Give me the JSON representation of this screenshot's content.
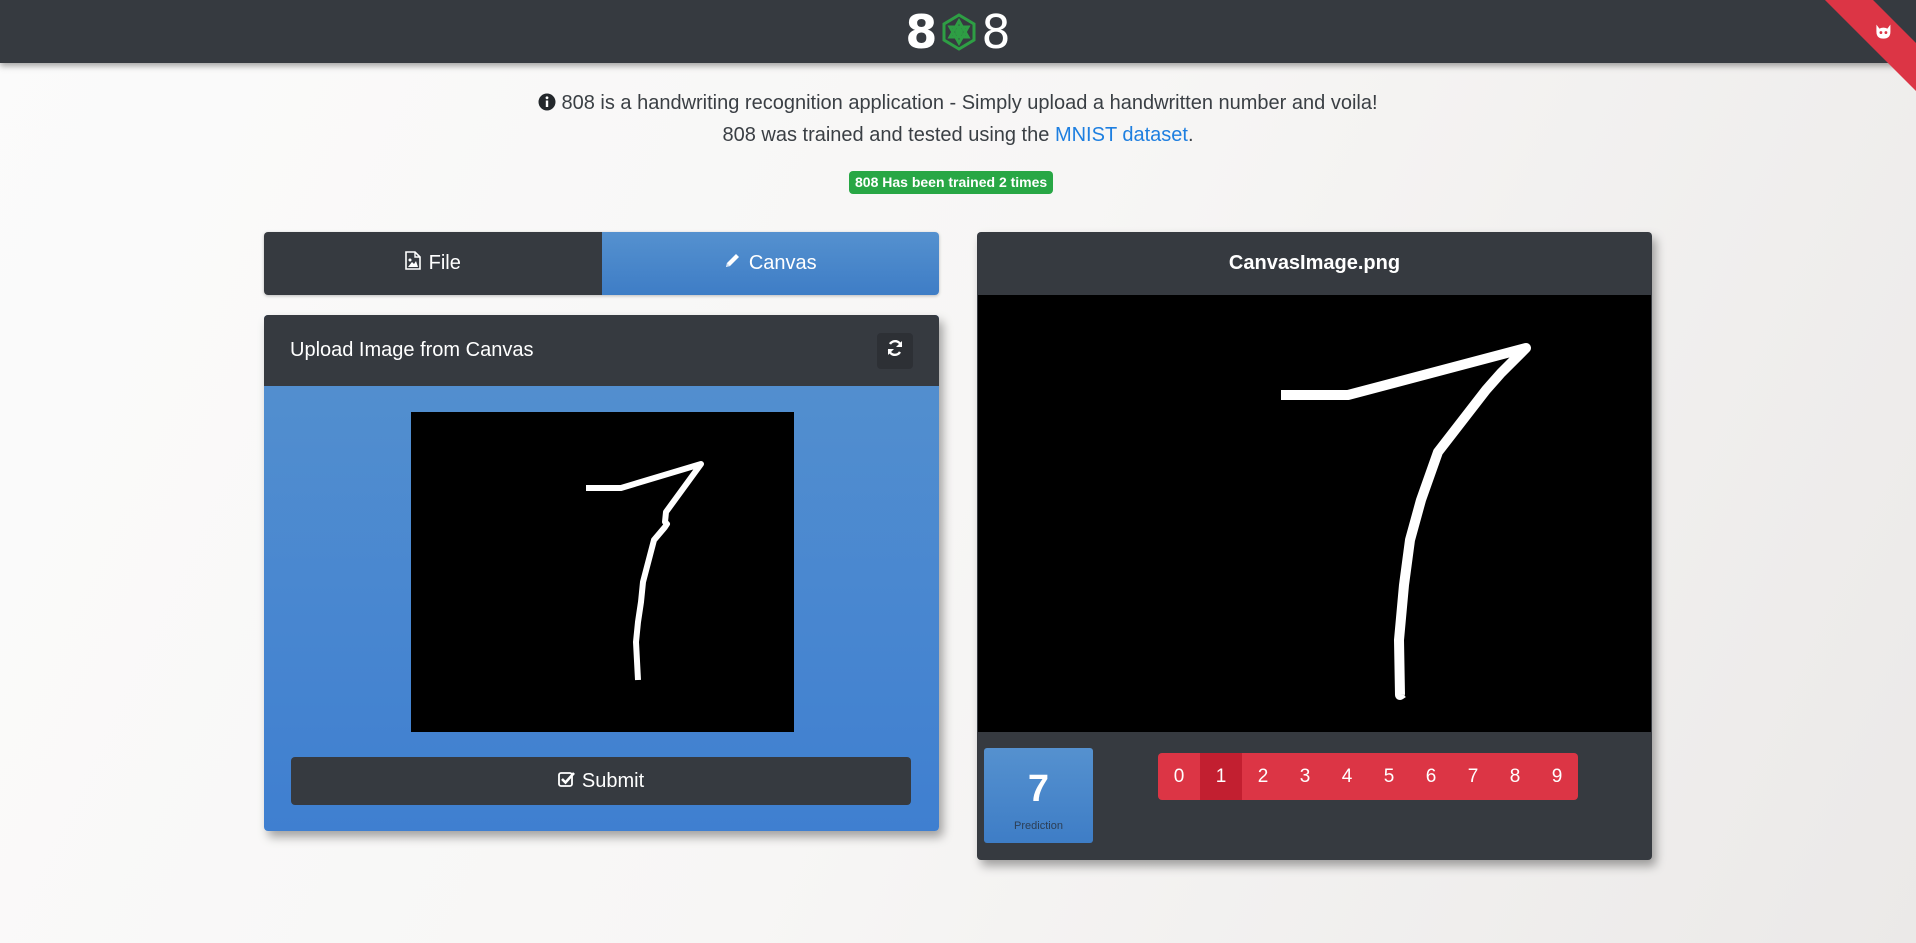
{
  "navbar": {
    "brand_left": "8",
    "brand_right": "8",
    "icons": {
      "brand_middle": "atom-logo-icon",
      "ribbon": "github-cat-icon"
    },
    "colors": {
      "background": "#363a40",
      "logo_green": "#2e9e44",
      "ribbon": "#dc3545"
    }
  },
  "intro": {
    "line1": "808 is a handwriting recognition application - Simply upload a handwritten number and voila!",
    "line2_prefix": "808 was trained and tested using the",
    "link_text": "MNIST dataset",
    "line2_suffix": ".",
    "icon": "info-circle-icon"
  },
  "badge": {
    "text": "808 Has been trained 2 times",
    "color": "#28a745"
  },
  "tabs": [
    {
      "label": "File",
      "icon": "file-image-icon",
      "active": false
    },
    {
      "label": "Canvas",
      "icon": "pencil-icon",
      "active": true
    }
  ],
  "upload_panel": {
    "title": "Upload Image from Canvas",
    "refresh_icon": "refresh-icon",
    "submit_label": "Submit",
    "submit_icon": "check-square-icon"
  },
  "result_panel": {
    "filename": "CanvasImage.png",
    "prediction_value": "7",
    "prediction_label": "Prediction",
    "digits": [
      "0",
      "1",
      "2",
      "3",
      "4",
      "5",
      "6",
      "7",
      "8",
      "9"
    ],
    "highlighted_digit": "1"
  },
  "colors": {
    "accent_blue": "#4a88cc",
    "danger": "#dc3545",
    "dark": "#363a40"
  }
}
